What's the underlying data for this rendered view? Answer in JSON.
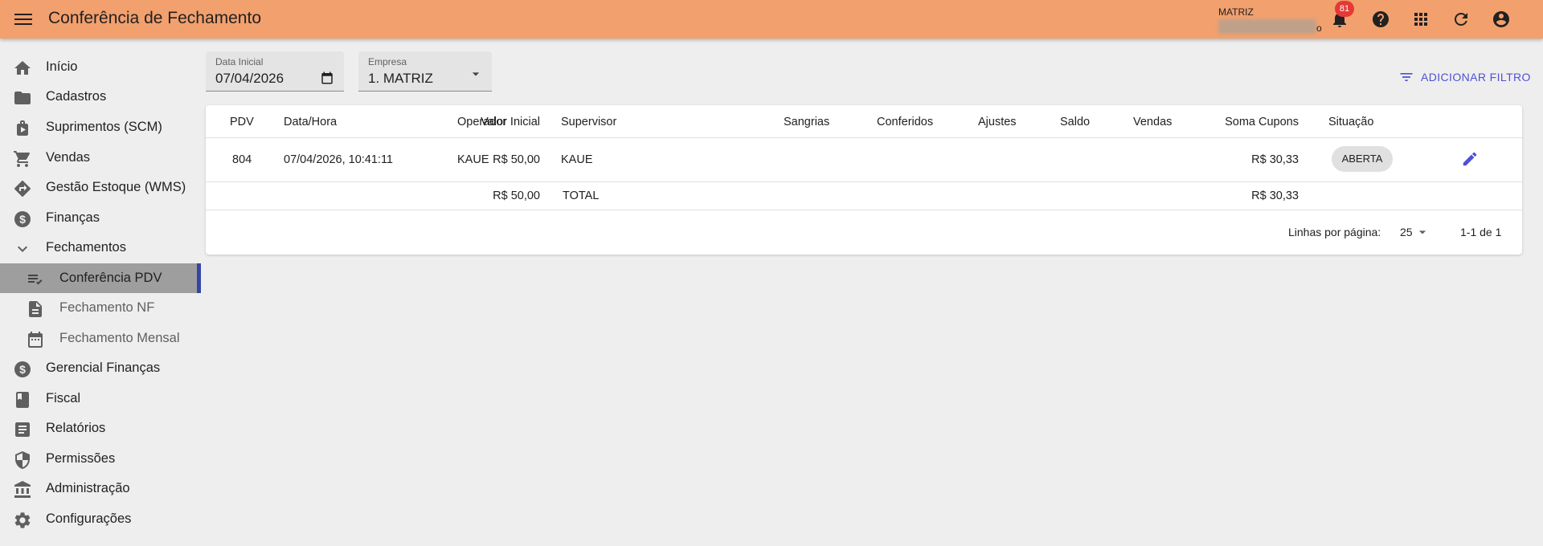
{
  "header": {
    "title": "Conferência de Fechamento",
    "company_label": "MATRIZ",
    "company_tail": "o",
    "notification_count": "81"
  },
  "sidebar": {
    "items": [
      {
        "label": "Início",
        "icon": "home-icon"
      },
      {
        "label": "Cadastros",
        "icon": "folder-icon"
      },
      {
        "label": "Suprimentos (SCM)",
        "icon": "supplies-icon"
      },
      {
        "label": "Vendas",
        "icon": "cart-icon"
      },
      {
        "label": "Gestão Estoque (WMS)",
        "icon": "directions-icon"
      },
      {
        "label": "Finanças",
        "icon": "dollar-circle-icon"
      },
      {
        "label": "Fechamentos",
        "icon": "chevron-down-icon"
      },
      {
        "label": "Conferência PDV",
        "icon": "checklist-icon"
      },
      {
        "label": "Fechamento NF",
        "icon": "document-icon"
      },
      {
        "label": "Fechamento Mensal",
        "icon": "calendar-icon"
      },
      {
        "label": "Gerencial Finanças",
        "icon": "dollar-circle-icon"
      },
      {
        "label": "Fiscal",
        "icon": "book-icon"
      },
      {
        "label": "Relatórios",
        "icon": "report-icon"
      },
      {
        "label": "Permissões",
        "icon": "shield-icon"
      },
      {
        "label": "Administração",
        "icon": "bank-icon"
      },
      {
        "label": "Configurações",
        "icon": "gear-icon"
      }
    ]
  },
  "filters": {
    "date_label": "Data Inicial",
    "date_value": "07/04/2026",
    "company_label": "Empresa",
    "company_value": "1. MATRIZ",
    "add_filter_label": "ADICIONAR FILTRO"
  },
  "table": {
    "columns": [
      "PDV",
      "Data/Hora",
      "Operador",
      "Supervisor",
      "Valor Inicial",
      "Sangrias",
      "Conferidos",
      "Ajustes",
      "Saldo",
      "Vendas",
      "Soma Cupons",
      "Situação"
    ],
    "rows": [
      {
        "pdv": "804",
        "datetime": "07/04/2026, 10:41:11",
        "operator": "KAUE",
        "supervisor": "KAUE",
        "initial_value": "R$ 50,00",
        "coupons_sum": "R$ 30,33",
        "status": "ABERTA"
      }
    ],
    "total": {
      "label": "TOTAL",
      "initial_value": "R$ 50,00",
      "coupons_sum": "R$ 30,33"
    }
  },
  "pagination": {
    "rows_per_page_label": "Linhas por página:",
    "rows_per_page": "25",
    "range": "1-1 de 1"
  },
  "colors": {
    "topbar": "#f2a06d",
    "accent": "#4f51d6",
    "active_indicator": "#3346a5",
    "badge": "#e53935"
  }
}
